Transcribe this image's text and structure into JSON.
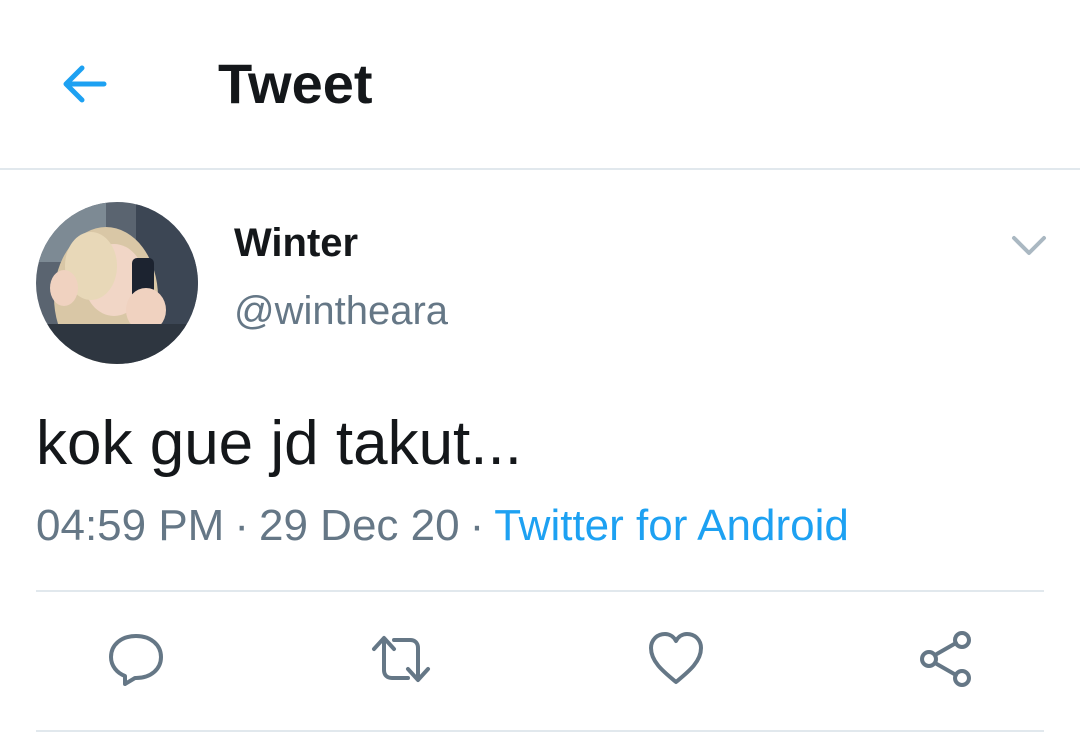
{
  "header": {
    "title": "Tweet",
    "back_icon": "arrow-left-icon"
  },
  "tweet": {
    "display_name": "Winter",
    "handle": "@wintheara",
    "text": "kok gue jd takut...",
    "time": "04:59 PM",
    "separator": "·",
    "date": "29 Dec 20",
    "source": "Twitter for Android"
  },
  "actions": [
    "reply-icon",
    "retweet-icon",
    "like-icon",
    "share-icon"
  ],
  "colors": {
    "accent": "#1da1f2",
    "secondary_text": "#657786",
    "divider": "#e1e8ed",
    "icon": "#657786"
  }
}
